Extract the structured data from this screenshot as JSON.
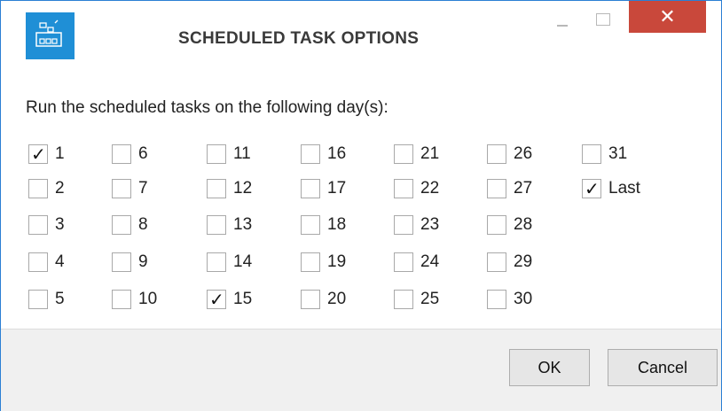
{
  "window": {
    "title": "SCHEDULED TASK OPTIONS",
    "close_glyph": "✕",
    "accent_color": "#1f8fd6",
    "close_color": "#c9483b"
  },
  "prompt": "Run the scheduled tasks on the following day(s):",
  "days": [
    {
      "label": "1",
      "checked": true
    },
    {
      "label": "2",
      "checked": false
    },
    {
      "label": "3",
      "checked": false
    },
    {
      "label": "4",
      "checked": false
    },
    {
      "label": "5",
      "checked": false
    },
    {
      "label": "6",
      "checked": false
    },
    {
      "label": "7",
      "checked": false
    },
    {
      "label": "8",
      "checked": false
    },
    {
      "label": "9",
      "checked": false
    },
    {
      "label": "10",
      "checked": false
    },
    {
      "label": "11",
      "checked": false
    },
    {
      "label": "12",
      "checked": false
    },
    {
      "label": "13",
      "checked": false
    },
    {
      "label": "14",
      "checked": false
    },
    {
      "label": "15",
      "checked": true
    },
    {
      "label": "16",
      "checked": false
    },
    {
      "label": "17",
      "checked": false
    },
    {
      "label": "18",
      "checked": false
    },
    {
      "label": "19",
      "checked": false
    },
    {
      "label": "20",
      "checked": false
    },
    {
      "label": "21",
      "checked": false
    },
    {
      "label": "22",
      "checked": false
    },
    {
      "label": "23",
      "checked": false
    },
    {
      "label": "24",
      "checked": false
    },
    {
      "label": "25",
      "checked": false
    },
    {
      "label": "26",
      "checked": false
    },
    {
      "label": "27",
      "checked": false
    },
    {
      "label": "28",
      "checked": false
    },
    {
      "label": "29",
      "checked": false
    },
    {
      "label": "30",
      "checked": false
    },
    {
      "label": "31",
      "checked": false
    },
    {
      "label": "Last",
      "checked": true
    }
  ],
  "buttons": {
    "ok": "OK",
    "cancel": "Cancel"
  }
}
